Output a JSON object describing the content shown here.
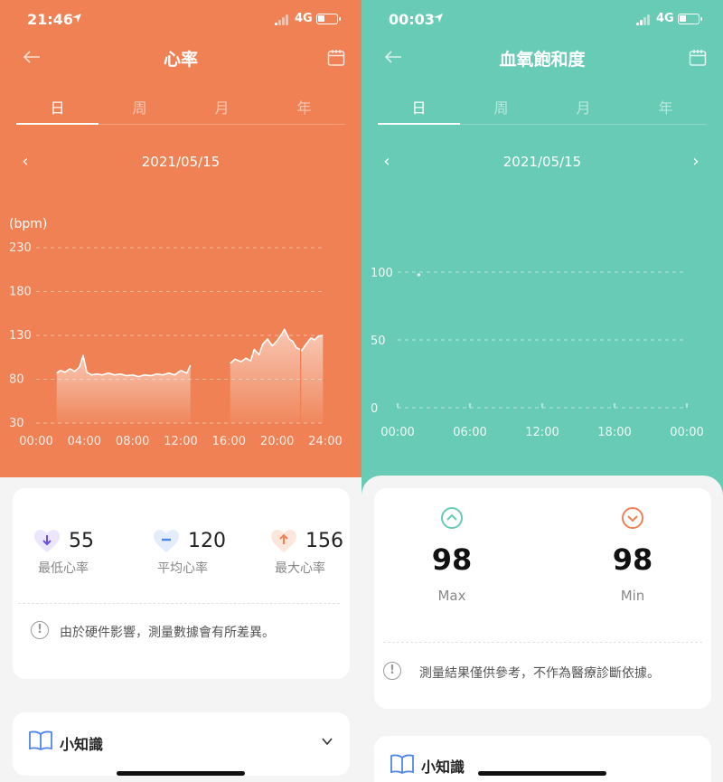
{
  "left": {
    "status": {
      "time": "21:46",
      "network": "4G"
    },
    "title": "心率",
    "tabs": [
      "日",
      "周",
      "月",
      "年"
    ],
    "active_tab": 0,
    "date": "2021/05/15",
    "stats": [
      {
        "value": "55",
        "label": "最低心率",
        "color": "#6a4fe0",
        "bg": "#ebe6fb",
        "icon": "arrow-down-icon"
      },
      {
        "value": "120",
        "label": "平均心率",
        "color": "#4f86e8",
        "bg": "#e4edfb",
        "icon": "minus-icon"
      },
      {
        "value": "156",
        "label": "最大心率",
        "color": "#ef8154",
        "bg": "#fde7dd",
        "icon": "arrow-up-icon"
      }
    ],
    "notice": "由於硬件影響，測量數據會有所差異。",
    "tips_label": "小知識"
  },
  "right": {
    "status": {
      "time": "00:03",
      "network": "4G"
    },
    "title": "血氧飽和度",
    "tabs": [
      "日",
      "周",
      "月",
      "年"
    ],
    "active_tab": 0,
    "date": "2021/05/15",
    "max": {
      "value": "98",
      "label": "Max"
    },
    "min": {
      "value": "98",
      "label": "Min"
    },
    "notice": "測量結果僅供參考，不作為醫療診斷依據。",
    "tips_label": "小知識"
  },
  "chart_data": [
    {
      "type": "area",
      "ylabel": "(bpm)",
      "ylim": [
        30,
        230
      ],
      "yticks": [
        "230",
        "180",
        "130",
        "80",
        "30"
      ],
      "xlim": [
        0,
        24
      ],
      "xticks": [
        "00:00",
        "04:00",
        "08:00",
        "12:00",
        "16:00",
        "20:00",
        "24:00"
      ],
      "segments": [
        [
          [
            1.7,
            87
          ],
          [
            2.0,
            90
          ],
          [
            2.4,
            88
          ],
          [
            2.8,
            92
          ],
          [
            3.2,
            89
          ],
          [
            3.6,
            94
          ],
          [
            3.9,
            107
          ],
          [
            4.2,
            88
          ],
          [
            4.6,
            85
          ],
          [
            5.0,
            86
          ],
          [
            5.5,
            85
          ],
          [
            6.0,
            87
          ],
          [
            6.5,
            85
          ],
          [
            7.0,
            86
          ],
          [
            7.5,
            84
          ],
          [
            8.0,
            85
          ],
          [
            8.5,
            83
          ],
          [
            9.0,
            85
          ],
          [
            9.5,
            84
          ],
          [
            10.0,
            86
          ],
          [
            10.5,
            85
          ],
          [
            11.0,
            87
          ],
          [
            11.5,
            85
          ],
          [
            12.0,
            90
          ],
          [
            12.5,
            87
          ],
          [
            12.8,
            96
          ]
        ],
        [
          [
            16.1,
            98
          ],
          [
            16.5,
            103
          ],
          [
            17.0,
            100
          ],
          [
            17.4,
            104
          ],
          [
            17.8,
            101
          ],
          [
            18.1,
            114
          ],
          [
            18.5,
            108
          ],
          [
            18.8,
            120
          ],
          [
            19.2,
            126
          ],
          [
            19.6,
            118
          ],
          [
            20.0,
            124
          ],
          [
            20.4,
            132
          ],
          [
            20.6,
            137
          ],
          [
            21.0,
            126
          ],
          [
            21.3,
            123
          ],
          [
            21.6,
            116
          ],
          [
            21.9,
            114
          ]
        ],
        [
          [
            22.0,
            112
          ],
          [
            22.4,
            120
          ],
          [
            22.8,
            127
          ],
          [
            23.1,
            125
          ],
          [
            23.4,
            129
          ],
          [
            23.8,
            130
          ]
        ]
      ],
      "grid": true,
      "legend": "none"
    },
    {
      "type": "scatter",
      "ylim": [
        0,
        100
      ],
      "yticks": [
        "100",
        "50",
        "0"
      ],
      "xticks": [
        "00:00",
        "06:00",
        "12:00",
        "18:00",
        "00:00"
      ],
      "points": [
        [
          1.75,
          98
        ]
      ],
      "grid": true,
      "legend": "none"
    }
  ]
}
